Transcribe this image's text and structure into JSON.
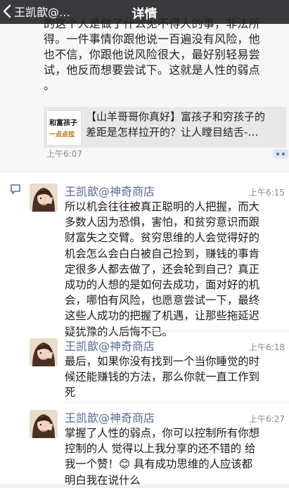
{
  "navbar": {
    "back_label": "王凯歆@…",
    "title": "详情"
  },
  "post": {
    "clipped_line": "的这个人是做了什么见不得人的事，非法所",
    "lines": [
      "得。一件事情你跟他说一百遍没有风险，他",
      "也不信，你跟他说风险很大，最好别轻易尝",
      "试，他反而想要尝试下。这就是人性的弱点",
      "。"
    ],
    "share": {
      "thumb_line1": "和富孩子",
      "thumb_line2": "一点点拉",
      "line1": "【山羊哥哥你真好】富孩子和穷孩子的",
      "line2": "差距是怎样拉开的？让人瞠目结舌-…"
    },
    "time": "上午6:07"
  },
  "comments": [
    {
      "name": "王凯歆@神奇商店",
      "time": "上午6:15",
      "lines": [
        "所以机会往往被真正聪明的人把握，而大",
        "多数人因为恐惧，害怕，和贫穷意识而跟",
        "财富失之交臂。贫穷思维的人会觉得好的",
        "机会怎么会白白被自己捡到，赚钱的事肯",
        "定很多人都去做了，还会轮到自己？真正",
        "成功的人想的是如何去成功，面对好的机",
        "会，哪怕有风险，也愿意尝试一下，最终",
        "这些人成功的把握了机遇，让那些拖延迟",
        "疑犹豫的人后悔不已。"
      ]
    },
    {
      "name": "王凯歆@神奇商店",
      "time": "上午6:18",
      "lines": [
        "最后，如果你没有找到一个当你睡觉的时",
        "候还能赚钱的方法，那么你就一直工作到",
        "死"
      ]
    },
    {
      "name": "王凯歆@神奇商店",
      "time": "上午6:27",
      "lines": [
        "掌握了人性的弱点，你可以控制所有你想",
        "控制的人 觉得以上我分享的还不错的 给",
        "我一个赞！😊 具有成功思维的人应该都",
        "明白我在说什么"
      ]
    }
  ],
  "colors": {
    "navbar": "#3a3a3e",
    "link_name": "#576b95",
    "timestamp": "#8a8a8a",
    "comment_bg": "#ffffff",
    "post_bg": "#f7f7f7"
  }
}
